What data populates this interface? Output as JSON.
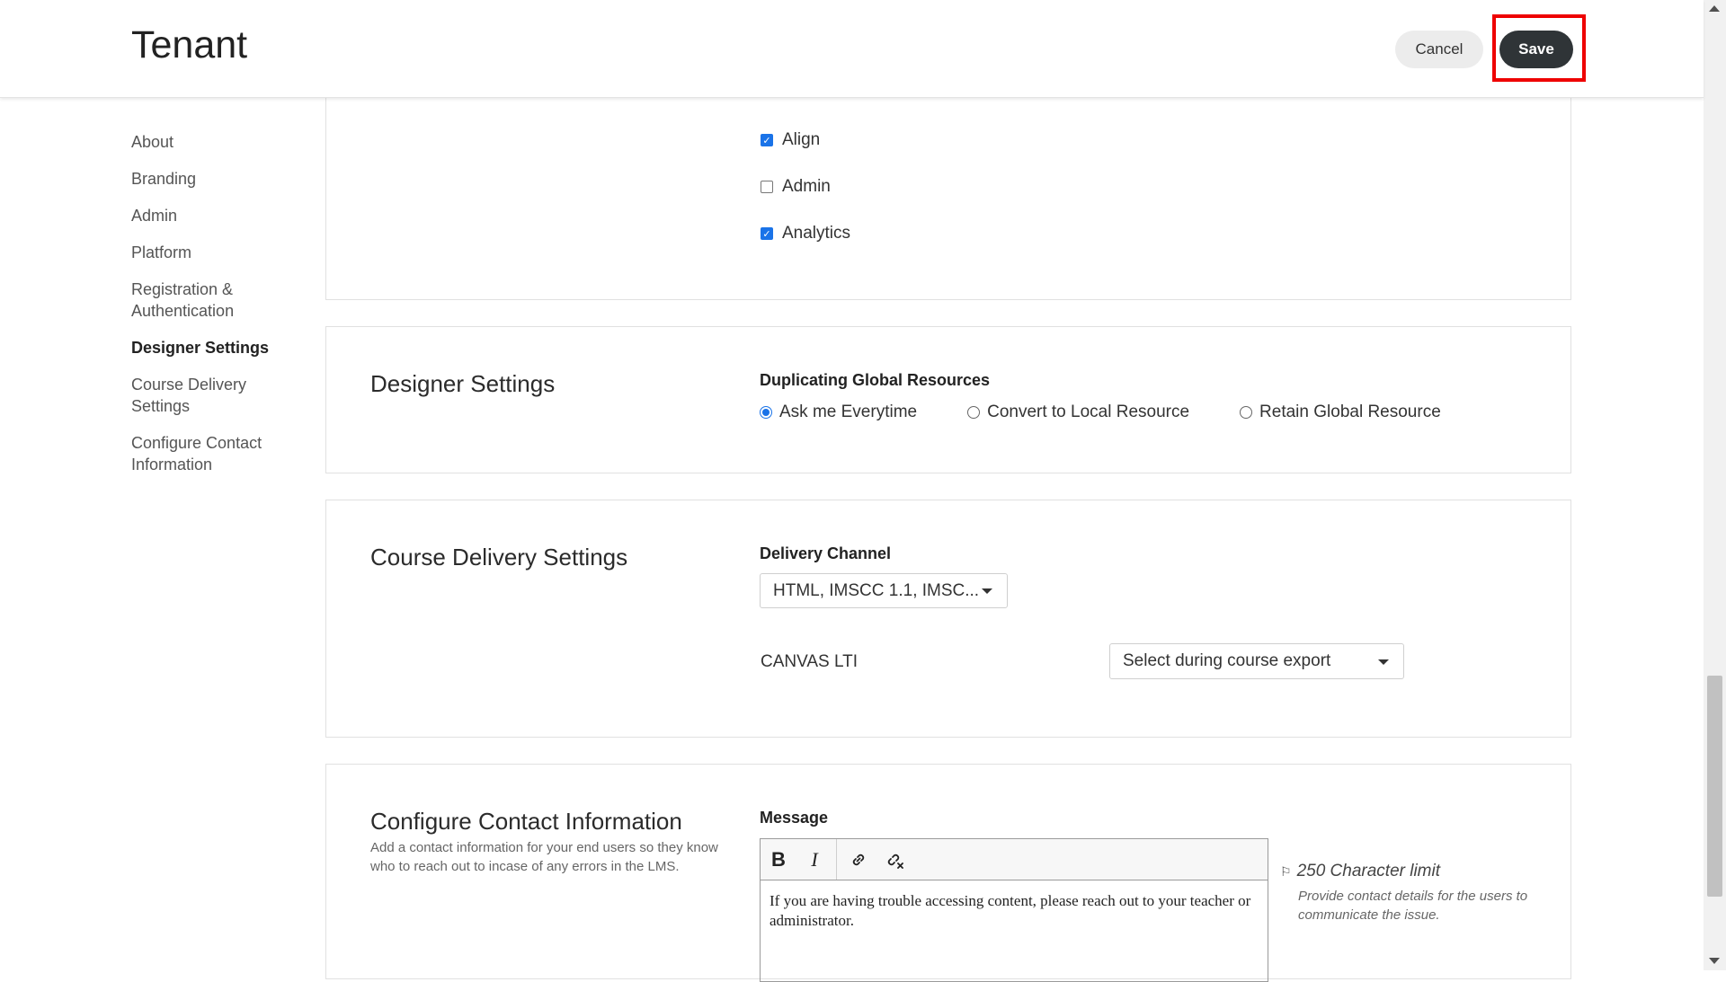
{
  "header": {
    "title": "Tenant",
    "cancel_label": "Cancel",
    "save_label": "Save"
  },
  "sidebar": {
    "items": [
      {
        "label": "About"
      },
      {
        "label": "Branding"
      },
      {
        "label": "Admin"
      },
      {
        "label": "Platform"
      },
      {
        "label": "Registration & Authentication"
      },
      {
        "label": "Designer Settings",
        "active": true
      },
      {
        "label": "Course Delivery Settings"
      },
      {
        "label": "Configure Contact Information"
      }
    ]
  },
  "modules": {
    "items": [
      {
        "label": "Align",
        "checked": true
      },
      {
        "label": "Admin",
        "checked": false
      },
      {
        "label": "Analytics",
        "checked": true
      }
    ]
  },
  "designer": {
    "title": "Designer Settings",
    "field_label": "Duplicating Global Resources",
    "options": [
      {
        "label": "Ask me Everytime",
        "selected": true
      },
      {
        "label": "Convert to Local Resource",
        "selected": false
      },
      {
        "label": "Retain Global Resource",
        "selected": false
      }
    ]
  },
  "delivery": {
    "title": "Course Delivery Settings",
    "channel_label": "Delivery Channel",
    "channel_value": "HTML, IMSCC 1.1, IMSC...",
    "lti_label": "CANVAS LTI",
    "lti_value": "Select during course export"
  },
  "contact": {
    "title": "Configure Contact Information",
    "description": "Add a contact information for your end users so they know who to reach out to incase of any errors in the LMS.",
    "message_label": "Message",
    "toolbar": {
      "bold": "B",
      "italic": "I"
    },
    "message_text": "If you are having trouble accessing content, please reach out to your teacher or administrator.",
    "char_limit": "250 Character limit",
    "char_desc": "Provide contact details for the users to communicate the issue."
  },
  "colors": {
    "accent": "#1a73e8",
    "save_bg": "#2f3437",
    "highlight": "#e00000"
  }
}
